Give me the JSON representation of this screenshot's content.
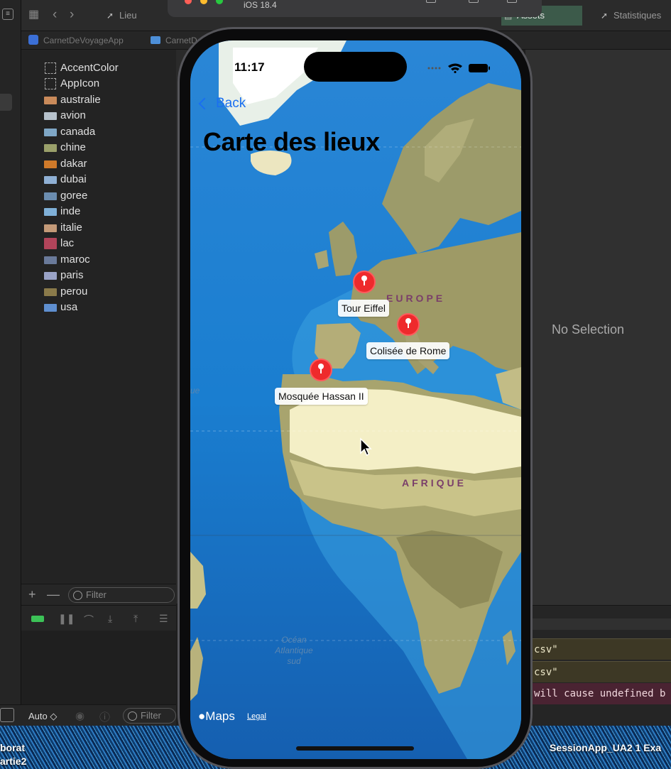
{
  "simulator": {
    "os_label": "iOS 18.4"
  },
  "xcode": {
    "tabs": [
      {
        "label": "Lieu"
      },
      {
        "label": "Assets"
      },
      {
        "label": "Statistiques"
      }
    ],
    "breadcrumb": {
      "project": "CarnetDeVoyageApp",
      "folder": "CarnetD"
    },
    "assets": [
      {
        "label": "AccentColor",
        "kind": "color"
      },
      {
        "label": "AppIcon",
        "kind": "appicon"
      },
      {
        "label": "australie",
        "thumb": "#c98a5a"
      },
      {
        "label": "avion",
        "thumb": "#b7c2cc"
      },
      {
        "label": "canada",
        "thumb": "#7fa7c6"
      },
      {
        "label": "chine",
        "thumb": "#9aa06a"
      },
      {
        "label": "dakar",
        "thumb": "#d07a2a"
      },
      {
        "label": "dubai",
        "thumb": "#8fb0d4"
      },
      {
        "label": "goree",
        "thumb": "#6b8db0"
      },
      {
        "label": "inde",
        "thumb": "#7fb0d8"
      },
      {
        "label": "italie",
        "thumb": "#c49a78"
      },
      {
        "label": "lac",
        "thumb": "#b2445a"
      },
      {
        "label": "maroc",
        "thumb": "#6a7a9a"
      },
      {
        "label": "paris",
        "thumb": "#9aa3c7"
      },
      {
        "label": "perou",
        "thumb": "#8a7a4a"
      },
      {
        "label": "usa",
        "thumb": "#5f8fd0"
      }
    ],
    "filter_placeholder": "Filter",
    "debug_filter_placeholder": "Filter",
    "scope_label": "Auto ◇",
    "inspector_empty": "No Selection",
    "console_lines": [
      {
        "text": "csv\"",
        "level": "warning"
      },
      {
        "text": "csv\"",
        "level": "warning"
      },
      {
        "text": "will cause undefined b",
        "level": "error"
      }
    ],
    "desktop_labels": {
      "left_line1": "borat",
      "left_line2": "artie2",
      "right": "SessionApp_UA2 1  Exa"
    }
  },
  "phone": {
    "time": "11:17",
    "back_label": "Back",
    "title": "Carte des lieux",
    "map": {
      "regions": [
        "EUROPE",
        "AFRIQUE"
      ],
      "ocean_label": "Océan Atlantique sud",
      "ocean_label_lines": [
        "Océan",
        "Atlantique",
        "sud"
      ],
      "ocean_edge_label": "ue",
      "annotations": [
        {
          "name": "Tour Eiffel"
        },
        {
          "name": "Colisée de Rome"
        },
        {
          "name": "Mosquée Hassan II"
        }
      ],
      "attribution": "Maps",
      "legal": "Legal"
    },
    "colors": {
      "pin": "#ee2a2c",
      "back_link": "#1a6ff0"
    }
  }
}
